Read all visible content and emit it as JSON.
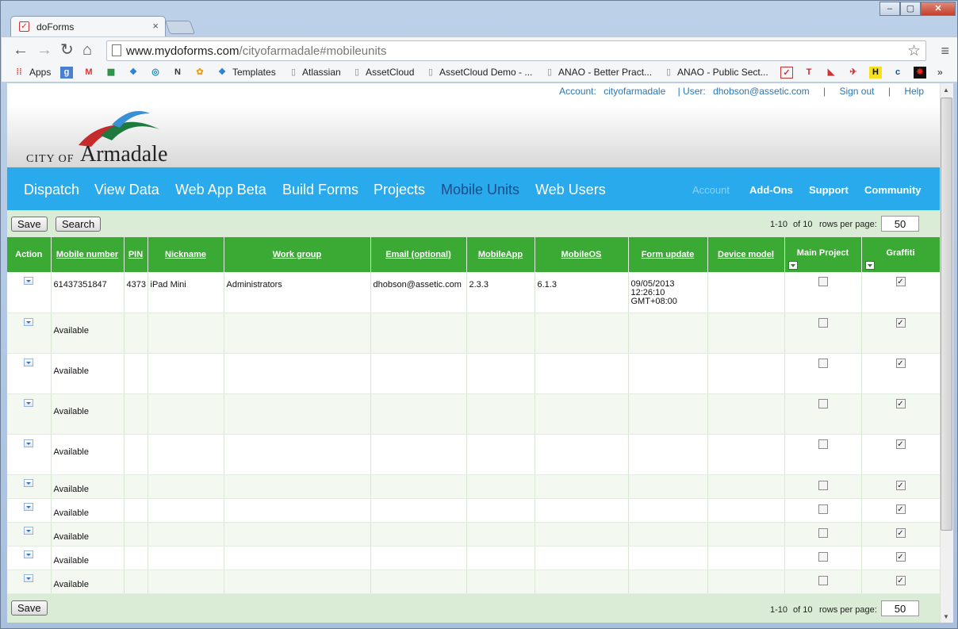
{
  "browser": {
    "tab_title": "doForms",
    "tab_close": "×",
    "url_domain": "www.mydoforms.com",
    "url_path": "/cityofarmadale#mobileunits",
    "window_min": "–",
    "window_max": "▢",
    "window_close": "✕",
    "bookmarks": [
      "Apps",
      "Templates",
      "Atlassian",
      "AssetCloud",
      "AssetCloud Demo - ...",
      "ANAO - Better Pract...",
      "ANAO - Public Sect..."
    ],
    "bookmarks_more": "»"
  },
  "header": {
    "account_label": "Account:",
    "account_value": "cityofarmadale",
    "user_label": "| User:",
    "user_value": "dhobson@assetic.com",
    "sign_out": "Sign out",
    "help": "Help",
    "sep": "|",
    "logo_small": "CITY OF",
    "logo_big": "Armadale"
  },
  "menu": {
    "left": [
      "Dispatch",
      "View Data",
      "Web App Beta",
      "Build Forms",
      "Projects",
      "Mobile Units",
      "Web Users"
    ],
    "active": "Mobile Units",
    "right": [
      "Account",
      "Add-Ons",
      "Support",
      "Community"
    ]
  },
  "controls": {
    "save": "Save",
    "search": "Search",
    "range": "1-10",
    "of": "of 10",
    "rpp_label": "rows per page:",
    "rpp_value": "50"
  },
  "table": {
    "headers": [
      "Action",
      "Mobile number",
      "PIN",
      "Nickname",
      "Work group",
      "Email (optional)",
      "MobileApp",
      "MobileOS",
      "Form update",
      "Device model",
      "Main Project",
      "Graffiti"
    ],
    "rows": [
      {
        "mobile": "61437351847",
        "pin": "4373",
        "nickname": "iPad Mini",
        "workgroup": "Administrators",
        "email": "dhobson@assetic.com",
        "app": "2.3.3",
        "os": "6.1.3",
        "update_date": "09/05/2013",
        "update_time": "12:26:10",
        "update_tz": "GMT+08:00",
        "device": "",
        "main": false,
        "graffiti": true
      },
      {
        "mobile": "Available",
        "main": false,
        "graffiti": true
      },
      {
        "mobile": "Available",
        "main": false,
        "graffiti": true
      },
      {
        "mobile": "Available",
        "main": false,
        "graffiti": true
      },
      {
        "mobile": "Available",
        "main": false,
        "graffiti": true
      },
      {
        "mobile": "Available",
        "main": false,
        "graffiti": true
      },
      {
        "mobile": "Available",
        "main": false,
        "graffiti": true
      },
      {
        "mobile": "Available",
        "main": false,
        "graffiti": true
      },
      {
        "mobile": "Available",
        "main": false,
        "graffiti": true
      },
      {
        "mobile": "Available",
        "main": false,
        "graffiti": true
      }
    ],
    "check_mark": "✓"
  },
  "colors": {
    "menubar": "#29aaec",
    "table_header": "#3aaa35",
    "active_menu": "#1d4e89"
  }
}
